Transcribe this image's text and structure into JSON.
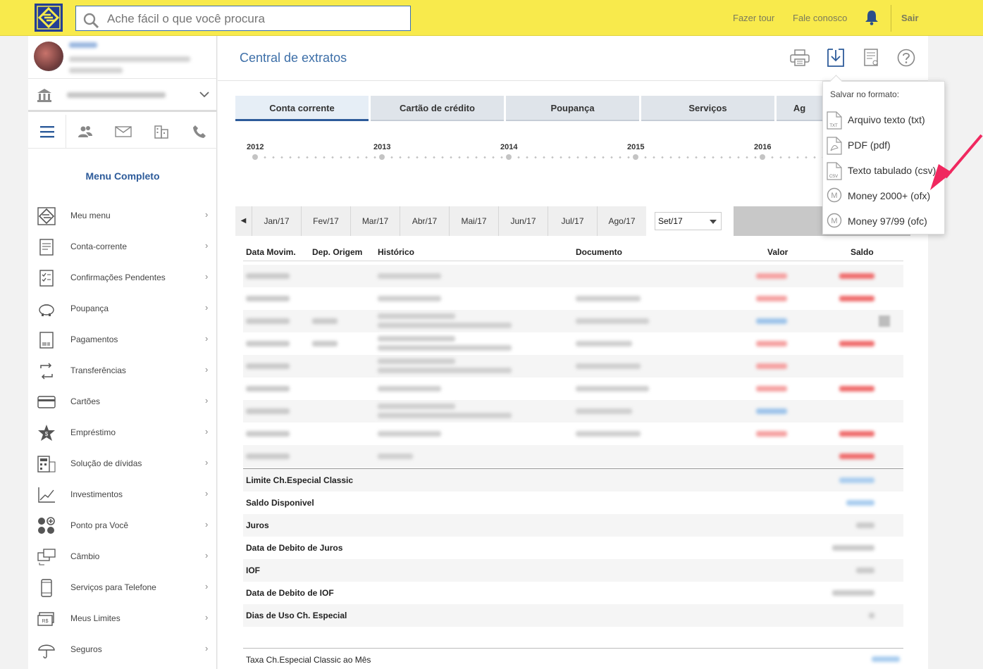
{
  "topbar": {
    "search_placeholder": "Ache fácil o que você procura",
    "tour_label": "Fazer tour",
    "contact_label": "Fale conosco",
    "logout_label": "Sair"
  },
  "sidebar": {
    "menu_title": "Menu Completo",
    "items": [
      {
        "label": "Meu menu",
        "icon": "bb-logo-icon"
      },
      {
        "label": "Conta-corrente",
        "icon": "statement-icon"
      },
      {
        "label": "Confirmações Pendentes",
        "icon": "checklist-icon"
      },
      {
        "label": "Poupança",
        "icon": "piggy-bank-icon"
      },
      {
        "label": "Pagamentos",
        "icon": "barcode-icon"
      },
      {
        "label": "Transferências",
        "icon": "transfer-icon"
      },
      {
        "label": "Cartões",
        "icon": "credit-card-icon"
      },
      {
        "label": "Empréstimo",
        "icon": "loan-star-icon"
      },
      {
        "label": "Solução de dívidas",
        "icon": "calculator-icon"
      },
      {
        "label": "Investimentos",
        "icon": "chart-up-icon"
      },
      {
        "label": "Ponto pra Você",
        "icon": "points-icon"
      },
      {
        "label": "Câmbio",
        "icon": "exchange-icon"
      },
      {
        "label": "Serviços para Telefone",
        "icon": "phone-icon"
      },
      {
        "label": "Meus Limites",
        "icon": "limits-icon"
      },
      {
        "label": "Seguros",
        "icon": "umbrella-icon"
      }
    ]
  },
  "main": {
    "title": "Central de extratos",
    "tabs": [
      "Conta corrente",
      "Cartão de crédito",
      "Poupança",
      "Serviços",
      "Ag"
    ],
    "years": [
      "2012",
      "2013",
      "2014",
      "2015",
      "2016"
    ],
    "months": [
      "Jan/17",
      "Fev/17",
      "Mar/17",
      "Abr/17",
      "Mai/17",
      "Jun/17",
      "Jul/17",
      "Ago/17"
    ],
    "selected_month": "Set/17",
    "columns": [
      "Data Movim.",
      "Dep. Origem",
      "Histórico",
      "Documento",
      "Valor",
      "Saldo"
    ],
    "summary_labels": [
      "Limite Ch.Especial Classic",
      "Saldo Disponivel",
      "Juros",
      "Data de Debito de Juros",
      "IOF",
      "Data de Debito de IOF",
      "Dias de Uso Ch. Especial"
    ],
    "taxa_label": "Taxa Ch.Especial Classic ao Mês"
  },
  "dropdown": {
    "header": "Salvar no formato:",
    "items": [
      {
        "label": "Arquivo texto (txt)",
        "icon": "txt-file-icon"
      },
      {
        "label": "PDF (pdf)",
        "icon": "pdf-file-icon"
      },
      {
        "label": "Texto tabulado (csv)",
        "icon": "csv-file-icon"
      },
      {
        "label": "Money 2000+ (ofx)",
        "icon": "money-icon"
      },
      {
        "label": "Money 97/99 (ofc)",
        "icon": "money-icon"
      }
    ]
  },
  "colors": {
    "topbar": "#f8ea4c",
    "brand_blue": "#243f94",
    "link_blue": "#2d5b9a",
    "highlight_arrow": "#f0285f"
  }
}
